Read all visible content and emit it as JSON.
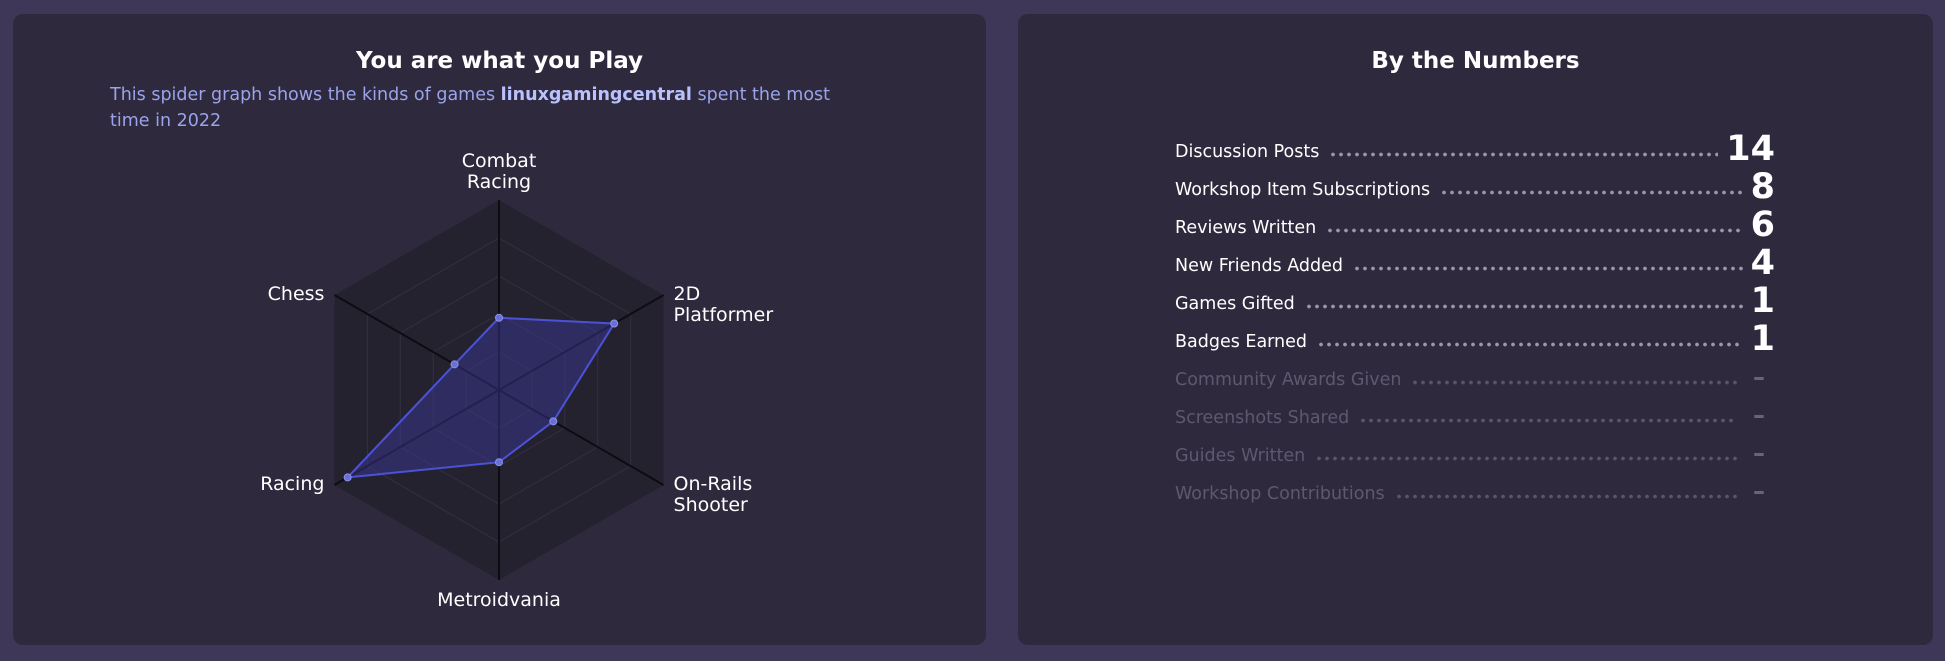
{
  "left_panel": {
    "title": "You are what you Play",
    "subtitle_pre": "This spider graph shows the kinds of games ",
    "username": "linuxgamingcentral",
    "subtitle_post": " spent the most time in 2022"
  },
  "radar": {
    "axes": [
      {
        "label_lines": [
          "Combat",
          "Racing"
        ],
        "value": 0.38
      },
      {
        "label_lines": [
          "2D",
          "Platformer"
        ],
        "value": 0.7
      },
      {
        "label_lines": [
          "On-Rails",
          "Shooter"
        ],
        "value": 0.33
      },
      {
        "label_lines": [
          "Metroidvania"
        ],
        "value": 0.38
      },
      {
        "label_lines": [
          "Racing"
        ],
        "value": 0.92
      },
      {
        "label_lines": [
          "Chess"
        ],
        "value": 0.27
      }
    ],
    "fill_color": "#3b3a9e",
    "stroke_color": "#4b52d8",
    "grid_color": "#26232f"
  },
  "right_panel": {
    "title": "By the Numbers",
    "stats": [
      {
        "label": "Discussion Posts",
        "value": "14",
        "active": true
      },
      {
        "label": "Workshop Item Subscriptions",
        "value": "8",
        "active": true
      },
      {
        "label": "Reviews Written",
        "value": "6",
        "active": true
      },
      {
        "label": "New Friends Added",
        "value": "4",
        "active": true
      },
      {
        "label": "Games Gifted",
        "value": "1",
        "active": true
      },
      {
        "label": "Badges Earned",
        "value": "1",
        "active": true
      },
      {
        "label": "Community Awards Given",
        "value": "–",
        "active": false
      },
      {
        "label": "Screenshots Shared",
        "value": "–",
        "active": false
      },
      {
        "label": "Guides Written",
        "value": "–",
        "active": false
      },
      {
        "label": "Workshop Contributions",
        "value": "–",
        "active": false
      }
    ]
  }
}
